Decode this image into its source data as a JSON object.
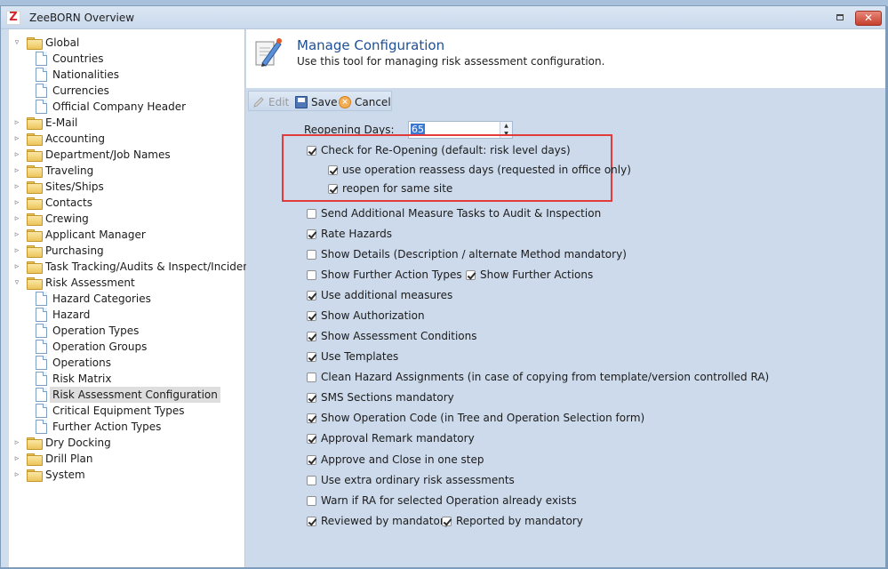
{
  "window": {
    "logo": "Z",
    "title": "ZeeBORN Overview",
    "close_glyph": "✕"
  },
  "sidebar": {
    "items": [
      {
        "label": "Global",
        "kind": "folder",
        "level": 0,
        "expander": "▿"
      },
      {
        "label": "Countries",
        "kind": "doc",
        "level": 1
      },
      {
        "label": "Nationalities",
        "kind": "doc",
        "level": 1
      },
      {
        "label": "Currencies",
        "kind": "doc",
        "level": 1
      },
      {
        "label": "Official Company Header",
        "kind": "doc",
        "level": 1
      },
      {
        "label": "E-Mail",
        "kind": "folder",
        "level": 0,
        "expander": "▹"
      },
      {
        "label": "Accounting",
        "kind": "folder",
        "level": 0,
        "expander": "▹"
      },
      {
        "label": "Department/Job Names",
        "kind": "folder",
        "level": 0,
        "expander": "▹"
      },
      {
        "label": "Traveling",
        "kind": "folder",
        "level": 0,
        "expander": "▹"
      },
      {
        "label": "Sites/Ships",
        "kind": "folder",
        "level": 0,
        "expander": "▹"
      },
      {
        "label": "Contacts",
        "kind": "folder",
        "level": 0,
        "expander": "▹"
      },
      {
        "label": "Crewing",
        "kind": "folder",
        "level": 0,
        "expander": "▹"
      },
      {
        "label": "Applicant Manager",
        "kind": "folder",
        "level": 0,
        "expander": "▹"
      },
      {
        "label": "Purchasing",
        "kind": "folder",
        "level": 0,
        "expander": "▹"
      },
      {
        "label": "Task Tracking/Audits & Inspect/Incidents",
        "kind": "folder",
        "level": 0,
        "expander": "▹"
      },
      {
        "label": "Risk Assessment",
        "kind": "folder",
        "level": 0,
        "expander": "▿"
      },
      {
        "label": "Hazard Categories",
        "kind": "doc",
        "level": 1
      },
      {
        "label": "Hazard",
        "kind": "doc",
        "level": 1
      },
      {
        "label": "Operation Types",
        "kind": "doc",
        "level": 1
      },
      {
        "label": "Operation Groups",
        "kind": "doc",
        "level": 1
      },
      {
        "label": "Operations",
        "kind": "doc",
        "level": 1
      },
      {
        "label": "Risk Matrix",
        "kind": "doc",
        "level": 1
      },
      {
        "label": "Risk Assessment Configuration",
        "kind": "doc",
        "level": 1,
        "selected": true
      },
      {
        "label": "Critical Equipment Types",
        "kind": "doc",
        "level": 1
      },
      {
        "label": "Further Action Types",
        "kind": "doc",
        "level": 1
      },
      {
        "label": "Dry Docking",
        "kind": "folder",
        "level": 0,
        "expander": "▹"
      },
      {
        "label": "Drill Plan",
        "kind": "folder",
        "level": 0,
        "expander": "▹"
      },
      {
        "label": "System",
        "kind": "folder",
        "level": 0,
        "expander": "▹"
      }
    ]
  },
  "header": {
    "title": "Manage Configuration",
    "subtitle": "Use this tool for managing risk assessment configuration."
  },
  "toolbar": {
    "edit_label": "Edit",
    "save_label": "Save",
    "cancel_label": "Cancel"
  },
  "form": {
    "reopening_days_label": "Reopening Days:",
    "reopening_days_value": "65",
    "checkboxes": [
      {
        "label": "Check for Re-Opening (default: risk level days)",
        "checked": true,
        "indent": 0
      },
      {
        "label": "use operation reassess days (requested in office only)",
        "checked": true,
        "indent": 1
      },
      {
        "label": "reopen for same site",
        "checked": true,
        "indent": 1
      },
      {
        "label": "Send Additional Measure Tasks to Audit & Inspection",
        "checked": false,
        "indent": 0
      },
      {
        "label": "Rate Hazards",
        "checked": true,
        "indent": 0
      },
      {
        "label": "Show Details (Description / alternate Method mandatory)",
        "checked": false,
        "indent": 0
      },
      {
        "label": "Show Further Action Types",
        "checked": false,
        "indent": 0,
        "partner": {
          "label": "Show Further Actions",
          "checked": true
        }
      },
      {
        "label": "Use additional measures",
        "checked": true,
        "indent": 0
      },
      {
        "label": "Show Authorization",
        "checked": true,
        "indent": 0
      },
      {
        "label": "Show Assessment Conditions",
        "checked": true,
        "indent": 0
      },
      {
        "label": "Use Templates",
        "checked": true,
        "indent": 0
      },
      {
        "label": "Clean Hazard Assignments (in case of copying from template/version controlled RA)",
        "checked": false,
        "indent": 0
      },
      {
        "label": "SMS Sections mandatory",
        "checked": true,
        "indent": 0
      },
      {
        "label": "Show Operation Code (in Tree and Operation Selection form)",
        "checked": true,
        "indent": 0
      },
      {
        "label": "Approval Remark mandatory",
        "checked": true,
        "indent": 0
      },
      {
        "label": "Approve and Close in one step",
        "checked": true,
        "indent": 0
      },
      {
        "label": "Use extra ordinary risk assessments",
        "checked": false,
        "indent": 0
      },
      {
        "label": "Warn if RA for selected Operation already exists",
        "checked": false,
        "indent": 0
      },
      {
        "label": "Reviewed by mandatory",
        "checked": true,
        "indent": 0,
        "partner": {
          "label": "Reported by mandatory",
          "checked": true
        }
      }
    ]
  }
}
